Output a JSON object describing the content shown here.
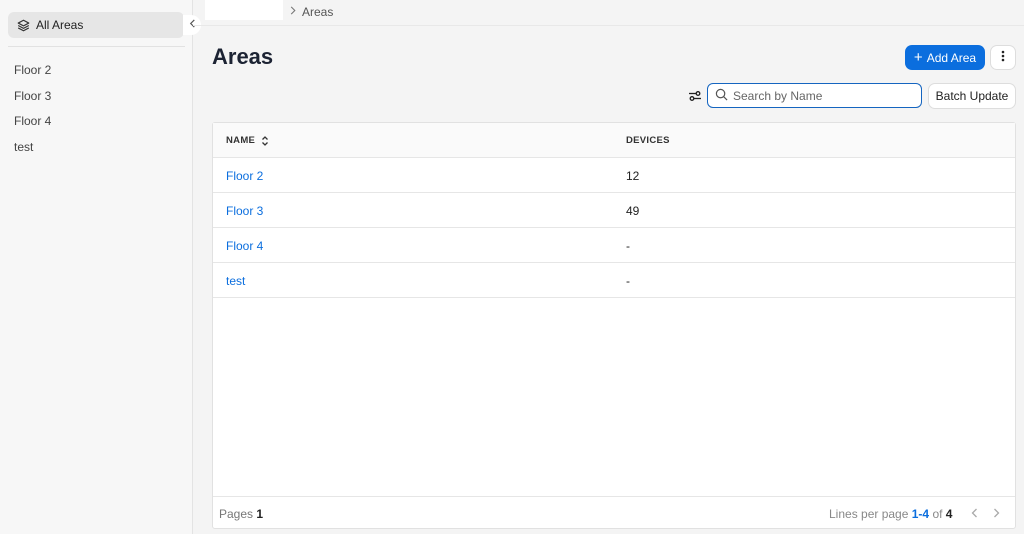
{
  "sidebar": {
    "all_areas_label": "All Areas",
    "items": [
      "Floor 2",
      "Floor 3",
      "Floor 4",
      "test"
    ]
  },
  "breadcrumb": {
    "current": "Areas"
  },
  "header": {
    "title": "Areas",
    "add_button": "Add Area",
    "batch_update": "Batch Update",
    "search_placeholder": "Search by Name"
  },
  "table": {
    "columns": {
      "name": "NAME",
      "devices": "DEVICES"
    },
    "rows": [
      {
        "name": "Floor 2",
        "devices": "12"
      },
      {
        "name": "Floor 3",
        "devices": "49"
      },
      {
        "name": "Floor 4",
        "devices": "-"
      },
      {
        "name": "test",
        "devices": "-"
      }
    ]
  },
  "footer": {
    "pages_label": "Pages",
    "pages_value": "1",
    "lines_label": "Lines per page",
    "range": "1-4",
    "of_label": "of",
    "total": "4"
  },
  "colors": {
    "accent": "#0b6ede",
    "link": "#0b6ede"
  }
}
